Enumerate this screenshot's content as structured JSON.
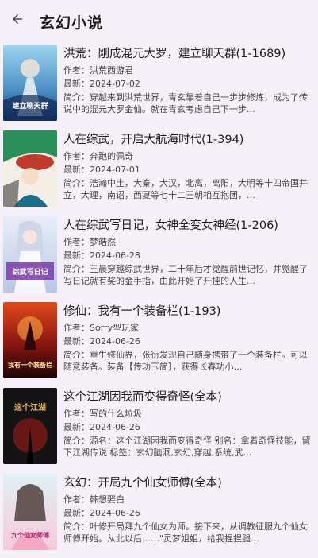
{
  "header": {
    "title": "玄幻小说",
    "back_icon": "arrow-left-icon"
  },
  "labels": {
    "author": "作者：",
    "updated": "最新：",
    "intro": "简介："
  },
  "books": [
    {
      "title": "洪荒：刚成混元大罗，建立聊天群(1-1689)",
      "author": "洪荒西游君",
      "updated": "2024-07-02",
      "intro": "穿越来到洪荒世界，青玄靠着自己一步步修炼，成为了传说中的混元大罗金仙。就在青玄考虑自己下一步…",
      "cover_text": "建立聊天群"
    },
    {
      "title": "人在综武，开启大航海时代(1-394)",
      "author": "奔跑的佩奇",
      "updated": "2024-07-01",
      "intro": "浩瀚中土，大秦，大汉，北离，离阳，大明等十四帝国并立，大理，南诏，西夏等七十二王朝相互抱团，…",
      "cover_text": ""
    },
    {
      "title": "人在综武写日记，女神全变女神经(1-206)",
      "author": "梦皓然",
      "updated": "2024-06-28",
      "intro": "王晨穿越综武世界，二十年后才觉醒前世记忆，并觉醒了写日记就有奖的金手指，由此开始了开挂的人生…",
      "cover_text": "综武写日记"
    },
    {
      "title": "修仙：我有一个装备栏(1-193)",
      "author": "Sorry型玩家",
      "updated": "2024-06-26",
      "intro": "重生修仙界，张衍发现自己随身携带了一个装备栏。可以随意装备。装备【传功玉简】，获得长春功小…",
      "cover_text": "我有一个装备栏"
    },
    {
      "title": "这个江湖因我而变得奇怪(全本)",
      "author": "写的什么垃圾",
      "updated": "2024-06-26",
      "intro": "源名：这个江湖因我而变得奇怪 别名：拿着奇怪技能，留下江湖传说 标签：玄幻脑洞,玄幻,穿越,系统,武…",
      "cover_text": "这个江湖"
    },
    {
      "title": "玄幻：开局九个仙女师傅(全本)",
      "author": "韩想娶白",
      "updated": "2024-06-26",
      "intro": "叶修开局拜九个仙女为师。接下来，从调教征服九个仙女师傅开始。从此以后……\"灵梦姐姐，给我捏捏腿…",
      "cover_text": "九个仙女师傅"
    }
  ]
}
